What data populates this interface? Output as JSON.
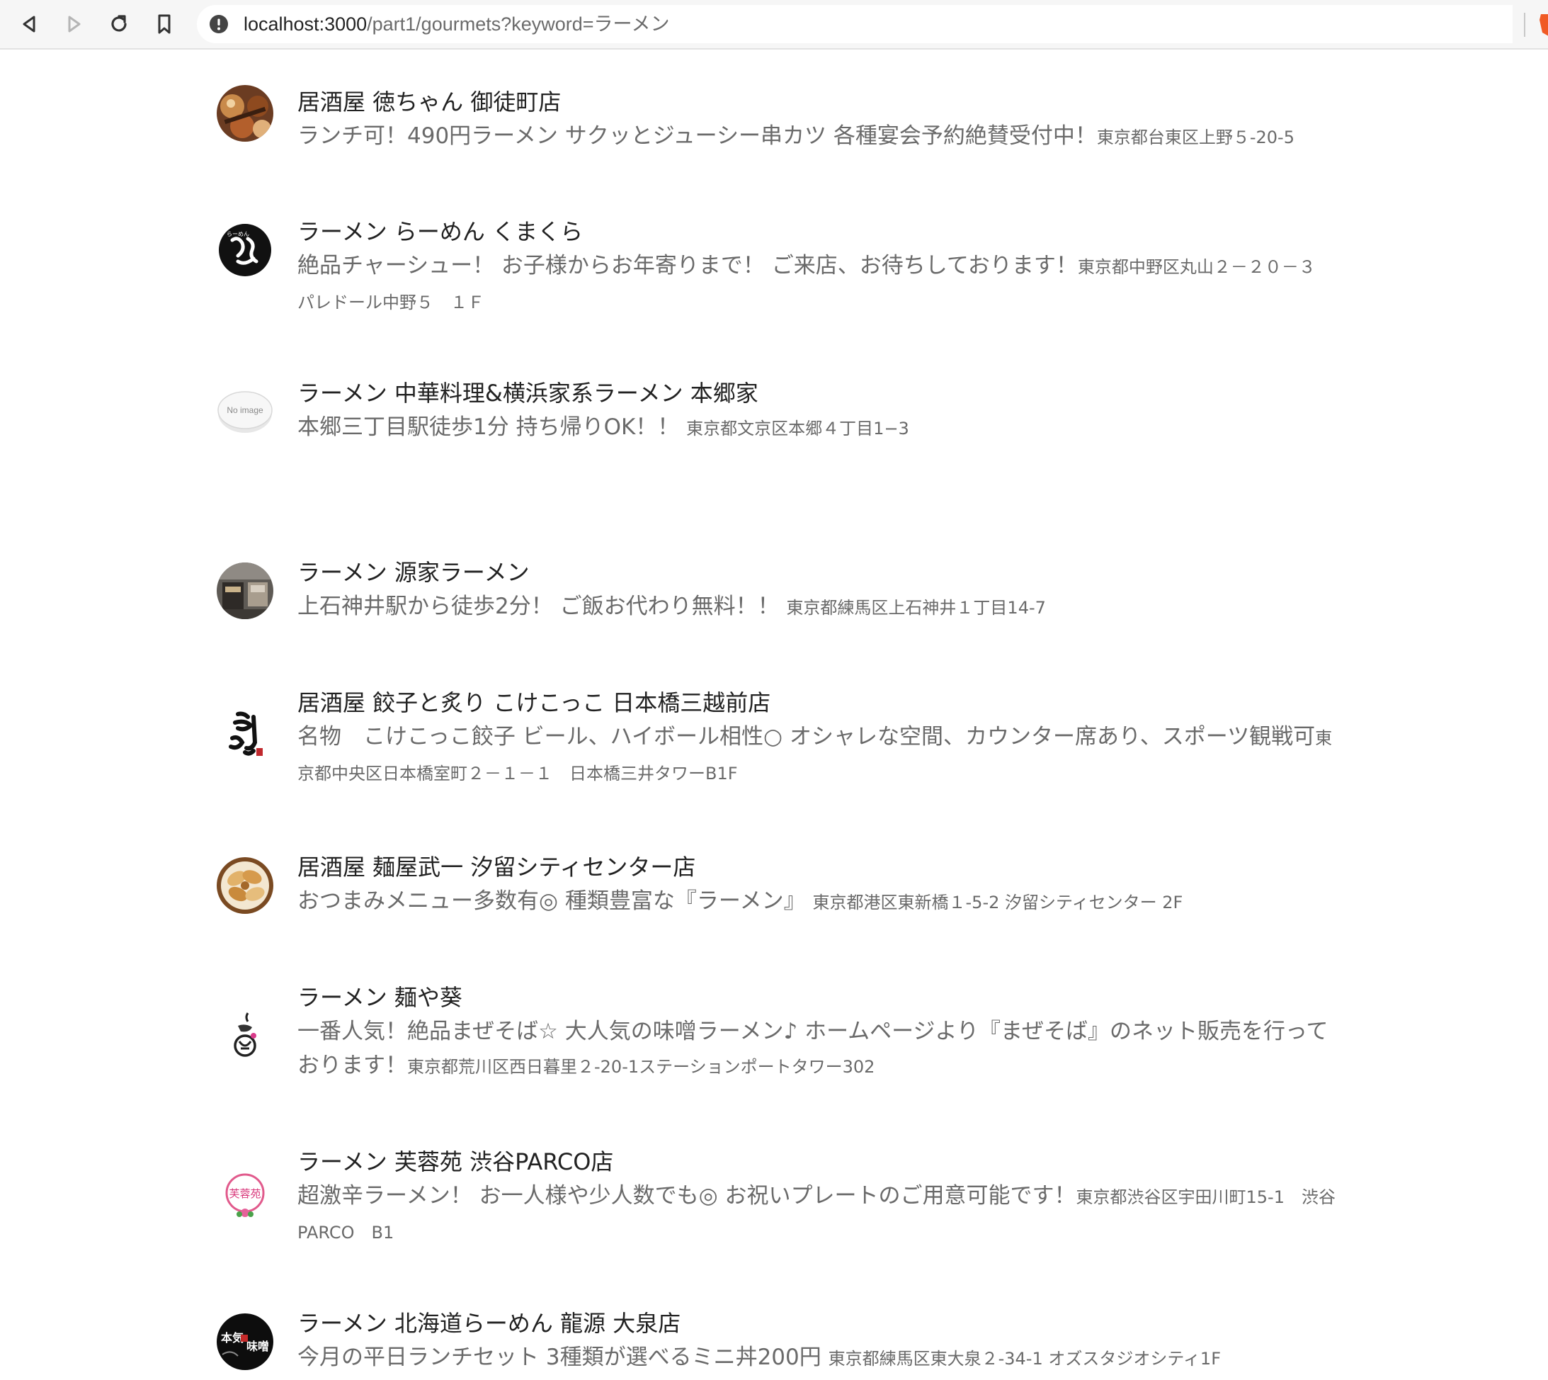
{
  "browser": {
    "url_host": "localhost:3000",
    "url_rest": "/part1/gourmets?keyword=ラーメン"
  },
  "shops": [
    {
      "name": "居酒屋 徳ちゃん 御徒町店",
      "catch": "ランチ可！490円ラーメン サクッとジューシー串カツ 各種宴会予約絶賛受付中！",
      "address": "東京都台東区上野５-20-5",
      "image": "food-photo-icon"
    },
    {
      "name": "ラーメン らーめん くまくら",
      "catch": "絶品チャーシュー！ お子様からお年寄りまで！ ご来店、お待ちしております！",
      "address": "東京都中野区丸山２－２０－３　パレドール中野５　１Ｆ",
      "image": "kumakura-logo-icon"
    },
    {
      "name": "ラーメン 中華料理&横浜家系ラーメン 本郷家",
      "catch": "本郷三丁目駅徒歩1分 持ち帰りOK！！ ",
      "address": "東京都文京区本郷４丁目1−3",
      "image": "no-image-icon",
      "no_image_label": "No image"
    },
    {
      "name": "ラーメン 源家ラーメン",
      "catch": "上石神井駅から徒歩2分！ ご飯お代わり無料！！ ",
      "address": "東京都練馬区上石神井１丁目14-7",
      "image": "storefront-photo-icon"
    },
    {
      "name": "居酒屋 餃子と炙り こけこっこ 日本橋三越前店",
      "catch": "名物　こけこっこ餃子 ビール、ハイボール相性○ オシャレな空間、カウンター席あり、スポーツ観戦可",
      "address": "東京都中央区日本橋室町２－１－１　日本橋三井タワーB1F",
      "image": "kokekokko-logo-icon"
    },
    {
      "name": "居酒屋 麺屋武一 汐留シティセンター店",
      "catch": "おつまみメニュー多数有◎ 種類豊富な『ラーメン』 ",
      "address": "東京都港区東新橋１-5-2 汐留シティセンター 2F",
      "image": "gyoza-photo-icon"
    },
    {
      "name": "ラーメン 麺や葵",
      "catch": "一番人気！絶品まぜそば☆ 大人気の味噌ラーメン♪ ホームページより『まぜそば』のネット販売を行っております！",
      "address": "東京都荒川区西日暮里２-20-1ステーションポートタワー302",
      "image": "menya-aoi-logo-icon"
    },
    {
      "name": "ラーメン 芙蓉苑 渋谷PARCO店",
      "catch": "超激辛ラーメン！ お一人様や少人数でも◎ お祝いプレートのご用意可能です！",
      "address": "東京都渋谷区宇田川町15-1　渋谷PARCO　B1",
      "image": "fuyoen-logo-icon"
    },
    {
      "name": "ラーメン 北海道らーめん 龍源 大泉店",
      "catch": "今月の平日ランチセット 3種類が選べるミニ丼200円 ",
      "address": "東京都練馬区東大泉２-34-1 オズスタジオシティ1F",
      "image": "ryugen-logo-icon"
    }
  ]
}
